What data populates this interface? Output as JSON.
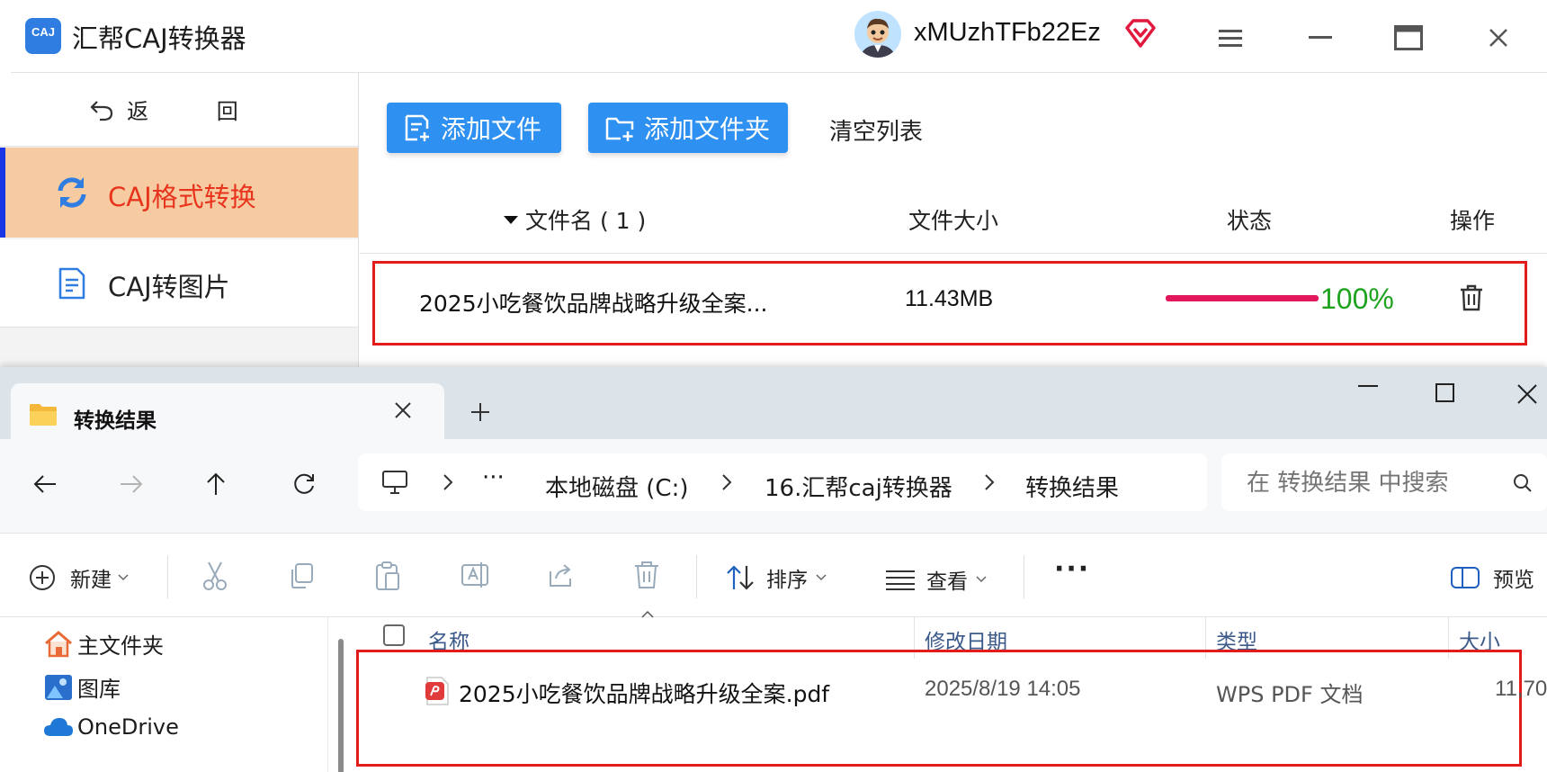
{
  "app": {
    "title": "汇帮CAJ转换器",
    "logo_text": "CAJ",
    "username": "xMUzhTFb22Ez"
  },
  "sidebar": {
    "back_label": "返 回",
    "items": [
      {
        "label": "CAJ格式转换",
        "active": true,
        "icon": "refresh-icon"
      },
      {
        "label": "CAJ转图片",
        "active": false,
        "icon": "document-icon"
      }
    ]
  },
  "toolbar": {
    "add_file": "添加文件",
    "add_folder": "添加文件夹",
    "clear_list": "清空列表"
  },
  "file_list": {
    "headers": {
      "name": "文件名 ( 1 )",
      "size": "文件大小",
      "status": "状态",
      "action": "操作"
    },
    "rows": [
      {
        "name": "2025小吃餐饮品牌战略升级全案...",
        "size": "11.43MB",
        "progress": 100,
        "progress_text": "100%"
      }
    ]
  },
  "colors": {
    "accent": "#2e90f0",
    "active_nav_bg": "#f6cba2",
    "active_nav_text": "#e8341c",
    "progress": "#e2185c",
    "progress_text": "#1fa21f",
    "highlight_box": "#e21b1b"
  },
  "explorer": {
    "tab_title": "转换结果",
    "path": [
      "本地磁盘 (C:)",
      "16.汇帮caj转换器",
      "转换结果"
    ],
    "path_ellipsis": "···",
    "search_placeholder": "在 转换结果 中搜索",
    "toolbar": {
      "new": "新建",
      "sort": "排序",
      "view": "查看",
      "more": "···",
      "preview": "预览"
    },
    "nav": [
      {
        "label": "主文件夹",
        "icon": "home-icon"
      },
      {
        "label": "图库",
        "icon": "gallery-icon"
      },
      {
        "label": "OneDrive",
        "icon": "cloud-icon"
      }
    ],
    "columns": {
      "name": "名称",
      "date": "修改日期",
      "type": "类型",
      "size": "大小"
    },
    "files": [
      {
        "name": "2025小吃餐饮品牌战略升级全案.pdf",
        "date": "2025/8/19 14:05",
        "type": "WPS PDF 文档",
        "size": "11,70"
      }
    ]
  }
}
